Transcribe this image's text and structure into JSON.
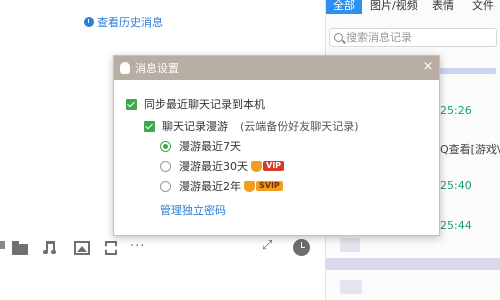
{
  "chat": {
    "history_link": "查看历史消息"
  },
  "toolbar": {
    "more": "···",
    "expand": "⤢"
  },
  "right_panel": {
    "tabs": [
      "全部",
      "图片/视频",
      "表情",
      "文件"
    ],
    "search_placeholder": "搜索消息记录",
    "times": [
      "25:26",
      "25:40",
      "25:44"
    ],
    "snippet": "Q查看[游戏\\"
  },
  "dialog": {
    "title": "消息设置",
    "close": "×",
    "sync_label": "同步最近聊天记录到本机",
    "roam_label": "聊天记录漫游",
    "roam_note": "(云端备份好友聊天记录)",
    "options": [
      {
        "label": "漫游最近7天",
        "selected": true,
        "badge": ""
      },
      {
        "label": "漫游最近30天",
        "selected": false,
        "badge": "VIP"
      },
      {
        "label": "漫游最近2年",
        "selected": false,
        "badge": "SVIP"
      }
    ],
    "manage_password": "管理独立密码"
  },
  "colors": {
    "accent_blue": "#2d8ff0",
    "check_green": "#3da94b",
    "title_bar": "#b7ada3",
    "time_green": "#1f9d7a",
    "vip_red": "#d43b2b",
    "svip_gold": "#f0a020"
  }
}
